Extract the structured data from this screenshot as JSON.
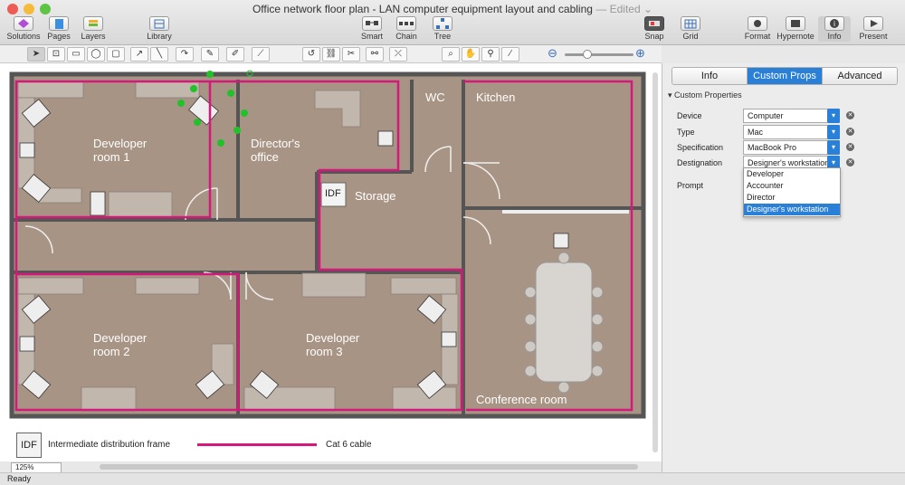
{
  "window": {
    "title": "Office network floor plan - LAN computer equipment layout and cabling",
    "edited": "— Edited ⌄"
  },
  "toolbar": {
    "solutions": "Solutions",
    "pages": "Pages",
    "layers": "Layers",
    "library": "Library",
    "smart": "Smart",
    "chain": "Chain",
    "tree": "Tree",
    "snap": "Snap",
    "grid": "Grid",
    "format": "Format",
    "hypernote": "Hypernote",
    "info": "Info",
    "present": "Present"
  },
  "plan": {
    "rooms": {
      "dev1": "Developer\nroom 1",
      "director": "Director's\noffice",
      "wc": "WC",
      "kitchen": "Kitchen",
      "storage": "Storage",
      "idf": "IDF",
      "dev2": "Developer\nroom 2",
      "dev3": "Developer\nroom 3",
      "conference": "Conference room"
    }
  },
  "legend": {
    "idf_badge": "IDF",
    "idf_label": "Intermediate distribution frame",
    "cable_label": "Cat 6 cable"
  },
  "status": {
    "zoom": "125%",
    "text": "Ready"
  },
  "panel": {
    "tabs": [
      "Info",
      "Custom Props",
      "Advanced"
    ],
    "section": "Custom Properties",
    "props": [
      {
        "label": "Device",
        "value": "Computer"
      },
      {
        "label": "Type",
        "value": "Mac"
      },
      {
        "label": "Specification",
        "value": "MacBook Pro"
      },
      {
        "label": "Destignation",
        "value": "Designer's workstation"
      }
    ],
    "prompt": "Prompt",
    "dropdown": [
      "Developer",
      "Accounter",
      "Director",
      "Designer's workstation"
    ]
  },
  "colors": {
    "floor": "#a89484",
    "wall": "#555555",
    "cable": "#d4197a",
    "accent": "#2a7fd6",
    "selection": "#22c02a"
  }
}
